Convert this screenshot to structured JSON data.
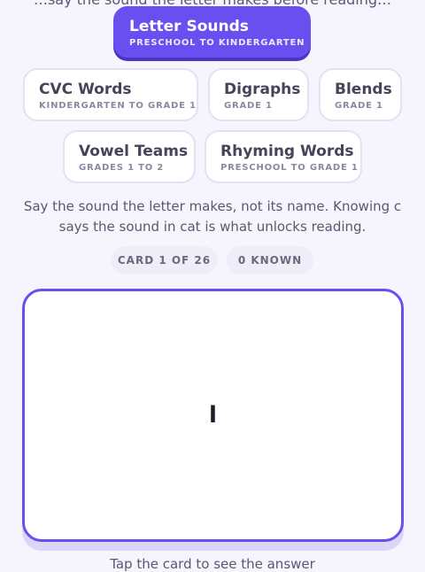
{
  "intro_partial": "…say the sound the letter makes before reading…",
  "categories": [
    {
      "title": "Letter Sounds",
      "subtitle": "PRESCHOOL TO KINDERGARTEN"
    },
    {
      "title": "CVC Words",
      "subtitle": "KINDERGARTEN TO GRADE 1"
    },
    {
      "title": "Digraphs",
      "subtitle": "GRADE 1"
    },
    {
      "title": "Blends",
      "subtitle": "GRADE 1"
    },
    {
      "title": "Vowel Teams",
      "subtitle": "GRADES 1 TO 2"
    },
    {
      "title": "Rhyming Words",
      "subtitle": "PRESCHOOL TO GRADE 1"
    }
  ],
  "description": "Say the sound the letter makes, not its name. Knowing c says the sound in cat is what unlocks reading.",
  "stats": {
    "card_progress": "CARD 1 OF 26",
    "known": "0 KNOWN"
  },
  "card": {
    "front": "l"
  },
  "hint": "Tap the card to see the answer",
  "colors": {
    "accent": "#6a4ff0",
    "background": "#f6f4fd"
  }
}
